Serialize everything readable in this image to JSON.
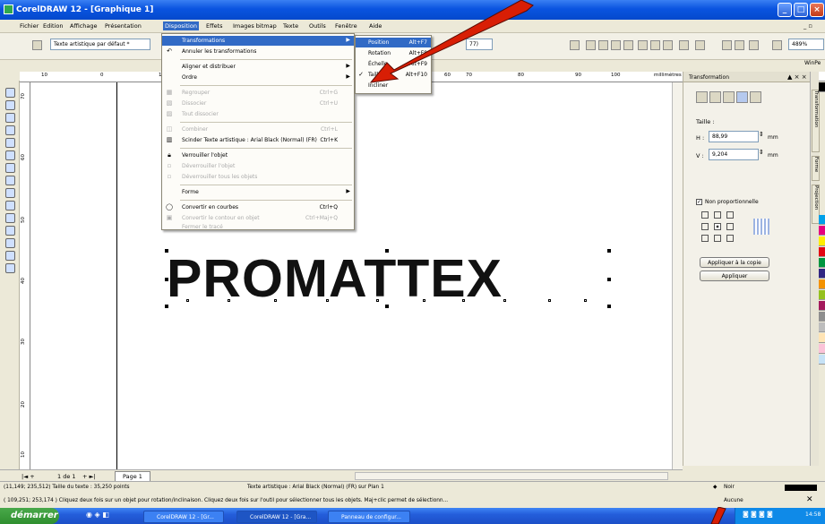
{
  "window": {
    "title": "CorelDRAW 12 - [Graphique 1]"
  },
  "menubar": {
    "items": [
      {
        "label": "Fichier"
      },
      {
        "label": "Edition"
      },
      {
        "label": "Affichage"
      },
      {
        "label": "Présentation"
      },
      {
        "label": "Disposition"
      },
      {
        "label": "Effets"
      },
      {
        "label": "Images bitmap"
      },
      {
        "label": "Texte"
      },
      {
        "label": "Outils"
      },
      {
        "label": "Fenêtre"
      },
      {
        "label": "Aide"
      }
    ]
  },
  "propbar": {
    "text_style": "Texte artistique par défaut *",
    "font_combo_fragment": "77)",
    "zoom": "489%",
    "winpe": "WinPe"
  },
  "menu_disposition": {
    "items": [
      {
        "label": "Transformations",
        "shortcut": "",
        "submenu": true,
        "disabled": false
      },
      {
        "label": "Annuler les transformations",
        "shortcut": "",
        "submenu": false,
        "disabled": false
      },
      {
        "label": "Aligner et distribuer",
        "shortcut": "",
        "submenu": true,
        "disabled": false
      },
      {
        "label": "Ordre",
        "shortcut": "",
        "submenu": true,
        "disabled": false
      },
      {
        "label": "Regrouper",
        "shortcut": "Ctrl+G",
        "submenu": false,
        "disabled": true
      },
      {
        "label": "Dissocier",
        "shortcut": "Ctrl+U",
        "submenu": false,
        "disabled": true
      },
      {
        "label": "Tout dissocier",
        "shortcut": "",
        "submenu": false,
        "disabled": true
      },
      {
        "label": "Combiner",
        "shortcut": "Ctrl+L",
        "submenu": false,
        "disabled": true
      },
      {
        "label": "Scinder Texte artistique : Arial Black (Normal) (FR)",
        "shortcut": "Ctrl+K",
        "submenu": false,
        "disabled": false
      },
      {
        "label": "Verrouiller l'objet",
        "shortcut": "",
        "submenu": false,
        "disabled": false
      },
      {
        "label": "Déverrouiller l'objet",
        "shortcut": "",
        "submenu": false,
        "disabled": true
      },
      {
        "label": "Déverrouiller tous les objets",
        "shortcut": "",
        "submenu": false,
        "disabled": true
      },
      {
        "label": "Forme",
        "shortcut": "",
        "submenu": true,
        "disabled": false
      },
      {
        "label": "Convertir en courbes",
        "shortcut": "Ctrl+Q",
        "submenu": false,
        "disabled": false
      },
      {
        "label": "Convertir le contour en objet",
        "shortcut": "Ctrl+Maj+Q",
        "submenu": false,
        "disabled": true
      },
      {
        "label": "Fermer le tracé",
        "shortcut": "",
        "submenu": false,
        "disabled": true
      }
    ]
  },
  "submenu_transformations": {
    "items": [
      {
        "label": "Position",
        "shortcut": "Alt+F7",
        "checked": false
      },
      {
        "label": "Rotation",
        "shortcut": "Alt+F8",
        "checked": false
      },
      {
        "label": "Échelle",
        "shortcut": "Alt+F9",
        "checked": false
      },
      {
        "label": "Taille",
        "shortcut": "Alt+F10",
        "checked": true
      },
      {
        "label": "Incliner",
        "shortcut": "",
        "checked": false
      }
    ]
  },
  "rulers": {
    "h": [
      "10",
      "0",
      "10",
      "20",
      "30",
      "40",
      "50",
      "60",
      "70",
      "80",
      "90",
      "100"
    ],
    "unit": "millimètres",
    "v": [
      "70",
      "60",
      "50",
      "40",
      "30",
      "20",
      "10"
    ]
  },
  "canvas": {
    "logo_text": "PROMATTEX"
  },
  "docker": {
    "title": "Transformation",
    "size_label": "Taille :",
    "h_label": "H :",
    "h_value": "88,99",
    "h_unit": "mm",
    "v_label": "V :",
    "v_value": "9,204",
    "v_unit": "mm",
    "non_proportional": "Non proportionnelle",
    "apply_copy": "Appliquer à la copie",
    "apply": "Appliquer",
    "tabs": [
      "Transformation",
      "Forme",
      "Projection"
    ]
  },
  "page_nav": {
    "counter": "1 de 1",
    "page_tab": "Page 1"
  },
  "status": {
    "line1_left": "(11,149; 235,512)  Taille du texte : 35,250 points",
    "line1_mid": "Texte artistique : Arial Black (Normal) (FR) sur Plan 1",
    "line2": "( 109,251; 253,174 )   Cliquez deux fois sur un objet pour rotation/inclinaison. Cliquez deux fois sur l'outil pour sélectionner tous les objets. Maj+clic permet de sélectionn...",
    "fill": "Noir",
    "outline": "Aucune"
  },
  "taskbar": {
    "start": "démarrer",
    "tasks": [
      "CorelDRAW 12 - [Gr...",
      "CorelDRAW 12 - [Gra...",
      "Panneau de configur..."
    ],
    "clock": "14:58"
  },
  "colors": {
    "accent": "#316ac5",
    "arrow": "#d81e05"
  }
}
